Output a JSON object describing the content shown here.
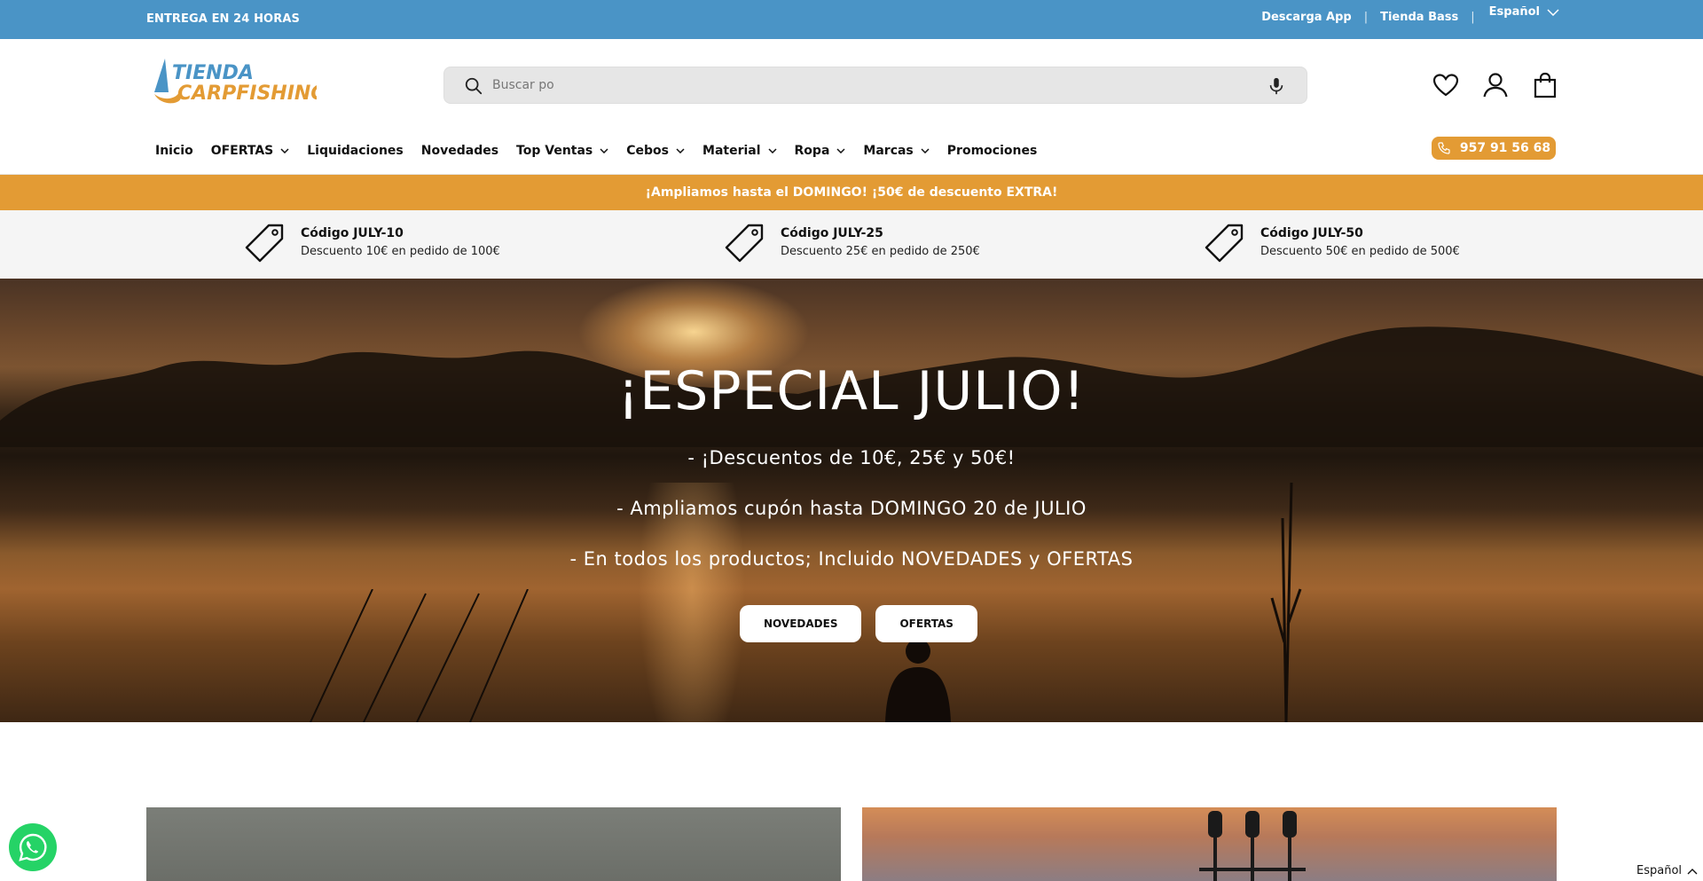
{
  "topbar": {
    "delivery": "ENTREGA EN 24 HORAS",
    "links": [
      "Descarga App",
      "Tienda Bass"
    ],
    "language": "Español"
  },
  "header": {
    "logo_line1": "TIENDA",
    "logo_line2": "CARPFISHING",
    "search_placeholder": "Buscar po",
    "phone": "957 91 56 68"
  },
  "nav": {
    "items": [
      {
        "label": "Inicio",
        "dropdown": false
      },
      {
        "label": "OFERTAS",
        "dropdown": true
      },
      {
        "label": "Liquidaciones",
        "dropdown": false
      },
      {
        "label": "Novedades",
        "dropdown": false
      },
      {
        "label": "Top Ventas",
        "dropdown": true
      },
      {
        "label": "Cebos",
        "dropdown": true
      },
      {
        "label": "Material",
        "dropdown": true
      },
      {
        "label": "Ropa",
        "dropdown": true
      },
      {
        "label": "Marcas",
        "dropdown": true
      },
      {
        "label": "Promociones",
        "dropdown": false
      }
    ]
  },
  "promo": {
    "text": "¡Ampliamos hasta el DOMINGO! ¡50€ de descuento EXTRA!"
  },
  "codes": [
    {
      "title": "Código JULY-10",
      "desc": "Descuento 10€ en pedido de 100€"
    },
    {
      "title": "Código JULY-25",
      "desc": "Descuento 25€ en pedido de 250€"
    },
    {
      "title": "Código JULY-50",
      "desc": "Descuento 50€ en pedido de 500€"
    }
  ],
  "hero": {
    "title": "¡ESPECIAL JULIO!",
    "lines": [
      "- ¡Descuentos de 10€, 25€ y 50€!",
      "- Ampliamos cupón hasta DOMINGO 20 de JULIO",
      "- En todos los productos; Incluido NOVEDADES y OFERTAS"
    ],
    "buttons": [
      "NOVEDADES",
      "OFERTAS"
    ]
  },
  "footer_lang": "Español",
  "colors": {
    "topbar": "#4a94c6",
    "accent_orange": "#e39b34",
    "whatsapp": "#25d366"
  }
}
